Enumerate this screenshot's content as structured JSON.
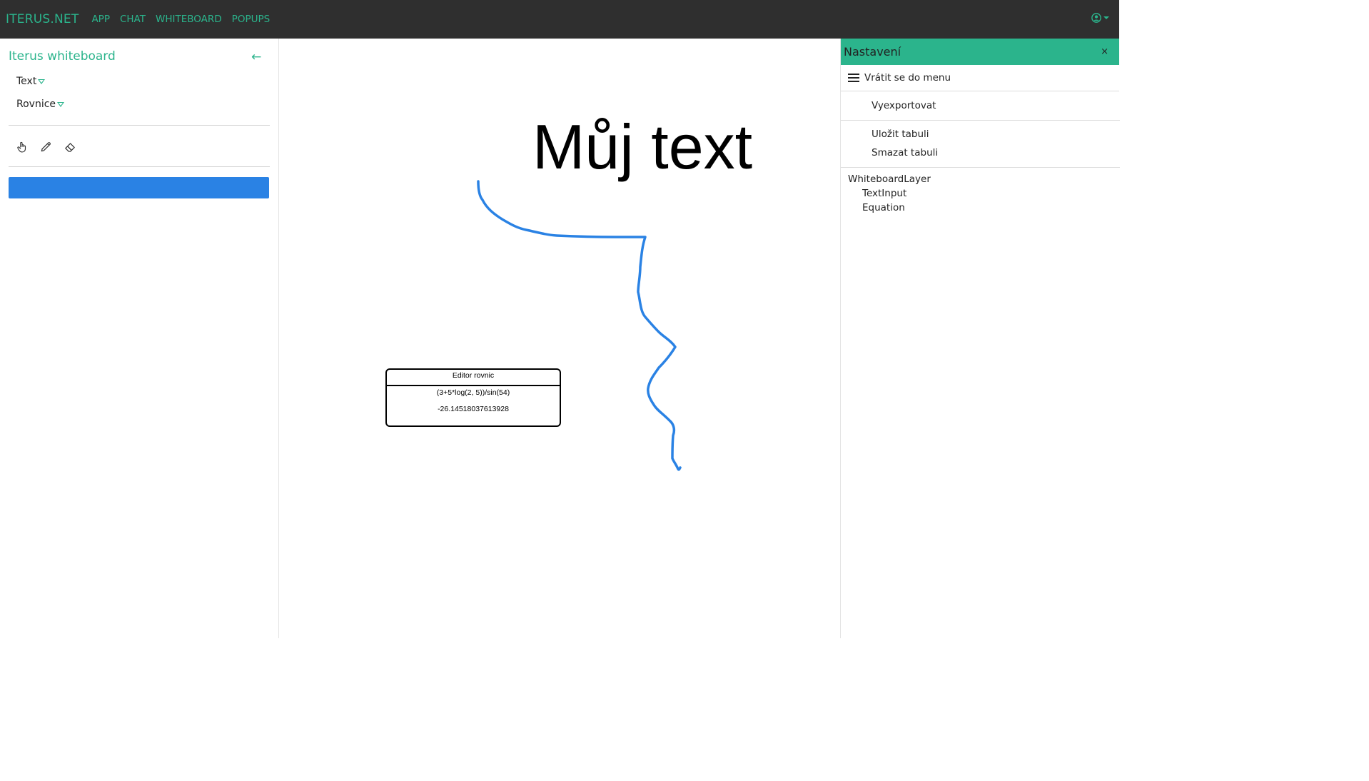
{
  "navbar": {
    "brand": "ITERUS.NET",
    "links": [
      "APP",
      "CHAT",
      "WHITEBOARD",
      "POPUPS"
    ],
    "accent": "#2bb48c",
    "background": "#2f2f2f"
  },
  "left_panel": {
    "title": "Iterus whiteboard",
    "back_icon": "arrow-left-icon",
    "menu": [
      "Text",
      "Rovnice"
    ],
    "tools": [
      "hand-icon",
      "pencil-icon",
      "eraser-icon"
    ],
    "action_color": "#2a82e4"
  },
  "canvas": {
    "text_item": "Můj text",
    "equation_editor": {
      "title": "Editor rovnic",
      "expression": "(3+5*log(2, 5))/sin(54)",
      "result": "-26.14518037613928"
    },
    "stroke_color": "#2a82e4"
  },
  "settings_panel": {
    "title": "Nastavení",
    "close_label": "×",
    "back_label": "Vrátit se do menu",
    "export_label": "Vyexportovat",
    "save_label": "Uložit tabuli",
    "delete_label": "Smazat tabuli",
    "layers": {
      "root": "WhiteboardLayer",
      "children": [
        "TextInput",
        "Equation"
      ]
    },
    "header_color": "#2bb48c"
  }
}
